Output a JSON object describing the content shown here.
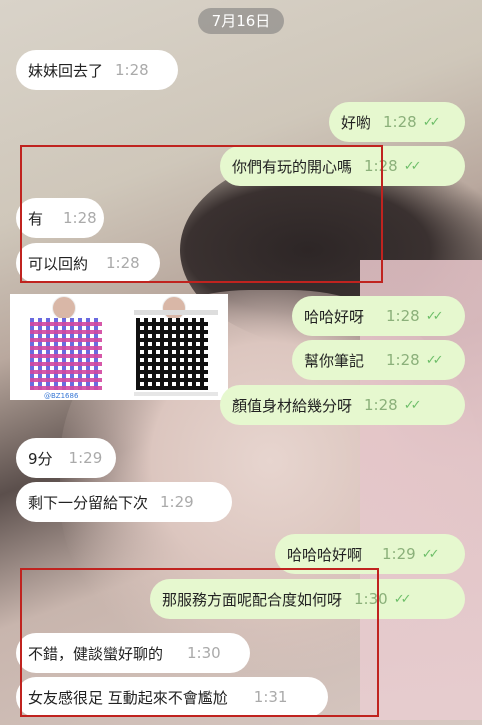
{
  "date_label": "7月16日",
  "messages": [
    {
      "text": "妹妹回去了",
      "time": "1:28"
    },
    {
      "text": "好喲",
      "time": "1:28"
    },
    {
      "text": "你們有玩的開心嗎",
      "time": "1:28"
    },
    {
      "text": "有",
      "time": "1:28"
    },
    {
      "text": "可以回約",
      "time": "1:28"
    },
    {
      "text": "哈哈好呀",
      "time": "1:28"
    },
    {
      "text": "幫你筆記",
      "time": "1:28"
    },
    {
      "text": "顏值身材給幾分呀",
      "time": "1:28"
    },
    {
      "text": "9分",
      "time": "1:29"
    },
    {
      "text": "剩下一分留給下次",
      "time": "1:29"
    },
    {
      "text": "哈哈哈好啊",
      "time": "1:29"
    },
    {
      "text": "那服務方面呢配合度如何呀",
      "time": "1:30"
    },
    {
      "text": "不錯，健談蠻好聊的",
      "time": "1:30"
    },
    {
      "text": "女友感很足 互動起來不會尷尬",
      "time": "1:31"
    }
  ],
  "qr_card": {
    "line_id": "@BZ1686"
  },
  "colors": {
    "incoming": "#ffffff",
    "outgoing": "#e6f8cf",
    "highlight": "#c0231f"
  }
}
